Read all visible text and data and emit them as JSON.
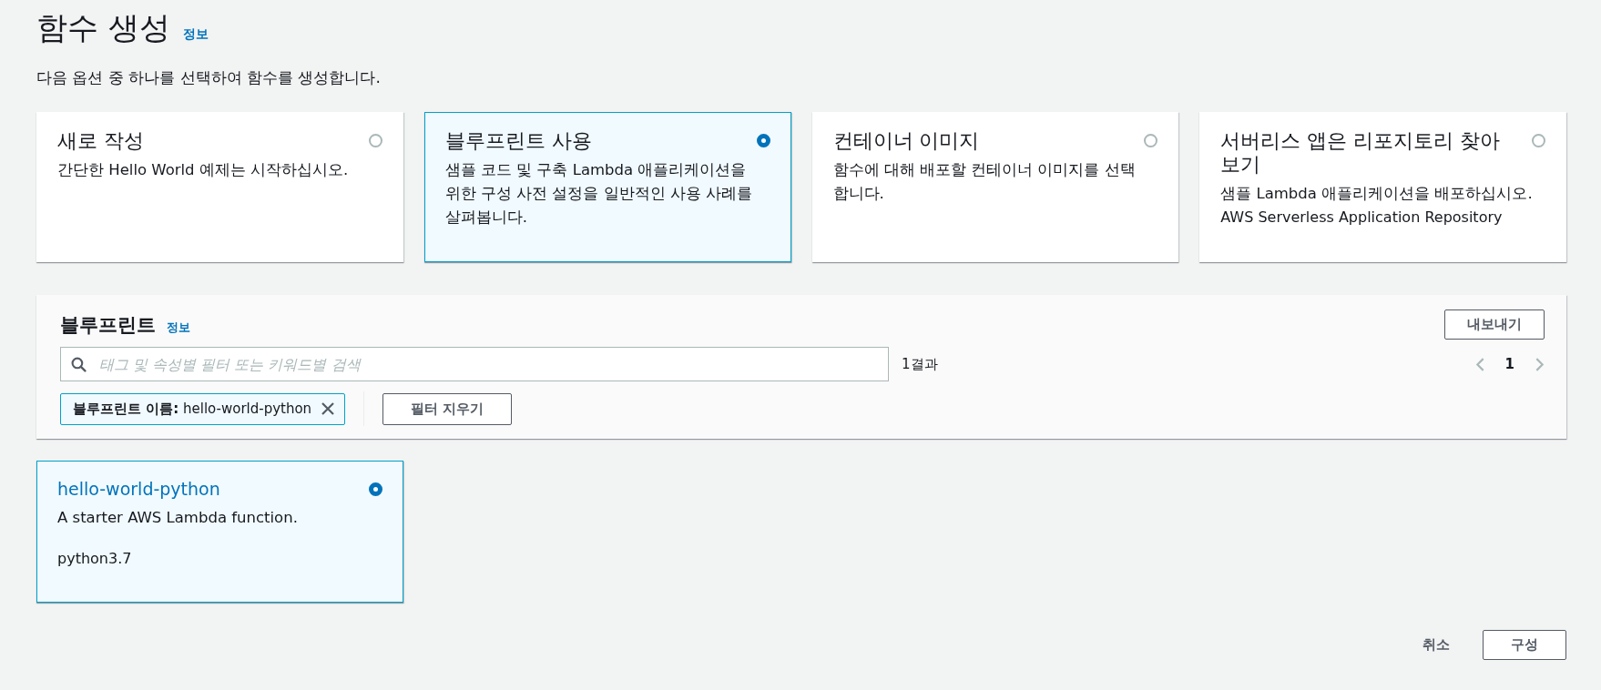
{
  "page": {
    "title": "함수 생성",
    "info_link": "정보",
    "description": "다음 옵션 중 하나를 선택하여 함수를 생성합니다."
  },
  "options": [
    {
      "title": "새로 작성",
      "description": "간단한 Hello World 예제는 시작하십시오.",
      "selected": false
    },
    {
      "title": "블루프린트 사용",
      "description": "샘플 코드 및 구축 Lambda 애플리케이션을 위한 구성 사전 설정을 일반적인 사용 사례를 살펴봅니다.",
      "selected": true
    },
    {
      "title": "컨테이너 이미지",
      "description": "함수에 대해 배포할 컨테이너 이미지를 선택합니다.",
      "selected": false
    },
    {
      "title": "서버리스 앱은 리포지토리 찾아보기",
      "description": "샘플 Lambda 애플리케이션을 배포하십시오.",
      "note": "AWS Serverless Application Repository",
      "selected": false
    }
  ],
  "blueprints": {
    "title": "블루프린트",
    "info_link": "정보",
    "export_button": "내보내기",
    "search": {
      "placeholder": "태그 및 속성별 필터 또는 키워드별 검색"
    },
    "result_count": "1결과",
    "page": "1",
    "filter_token": "**블루프린트 이름:** hello-world-python",
    "clear_filters_button": "필터 지우기"
  },
  "results": [
    {
      "name": "hello-world-python",
      "description": "A starter AWS Lambda function.",
      "runtime": "python3.7",
      "selected": true
    }
  ],
  "footer": {
    "cancel": "취소",
    "configure": "구성"
  }
}
